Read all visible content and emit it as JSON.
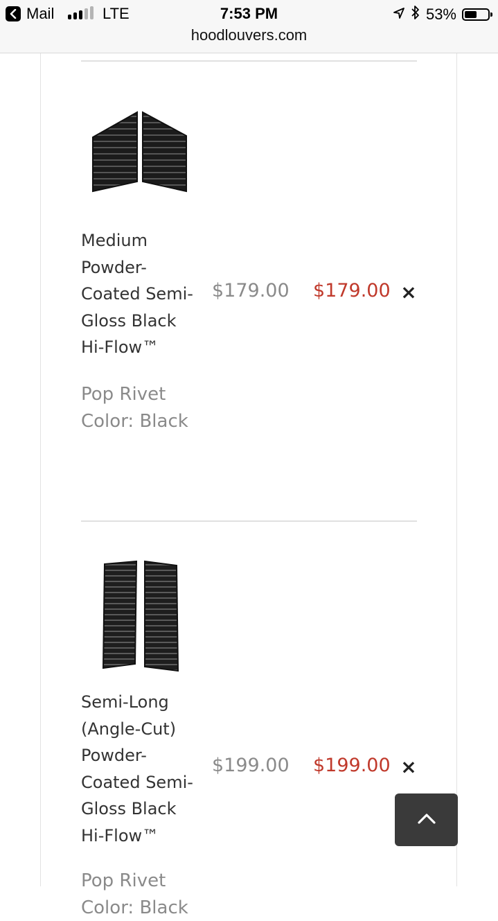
{
  "status_bar": {
    "back_app": "Mail",
    "carrier": "LTE",
    "time": "7:53 PM",
    "battery": "53%",
    "battery_level": 0.53,
    "signal_bars_on": 3,
    "signal_bars_total": 5
  },
  "browser": {
    "url": "hoodlouvers.com"
  },
  "cart": {
    "items": [
      {
        "name": "Medium Powder-Coated Semi-Gloss Black Hi-Flow™",
        "option": "Pop Rivet Color: Black",
        "price": "$179.00",
        "total": "$179.00",
        "remove": "×"
      },
      {
        "name": "Semi-Long (Angle-Cut) Powder-Coated Semi-Gloss Black Hi-Flow™",
        "option": "Pop Rivet Color: Black",
        "price": "$199.00",
        "total": "$199.00",
        "remove": "×"
      }
    ]
  },
  "colors": {
    "accent_price": "#c0392b",
    "muted_text": "#8a8a8a",
    "back_to_top_bg": "#3a3a3a"
  }
}
